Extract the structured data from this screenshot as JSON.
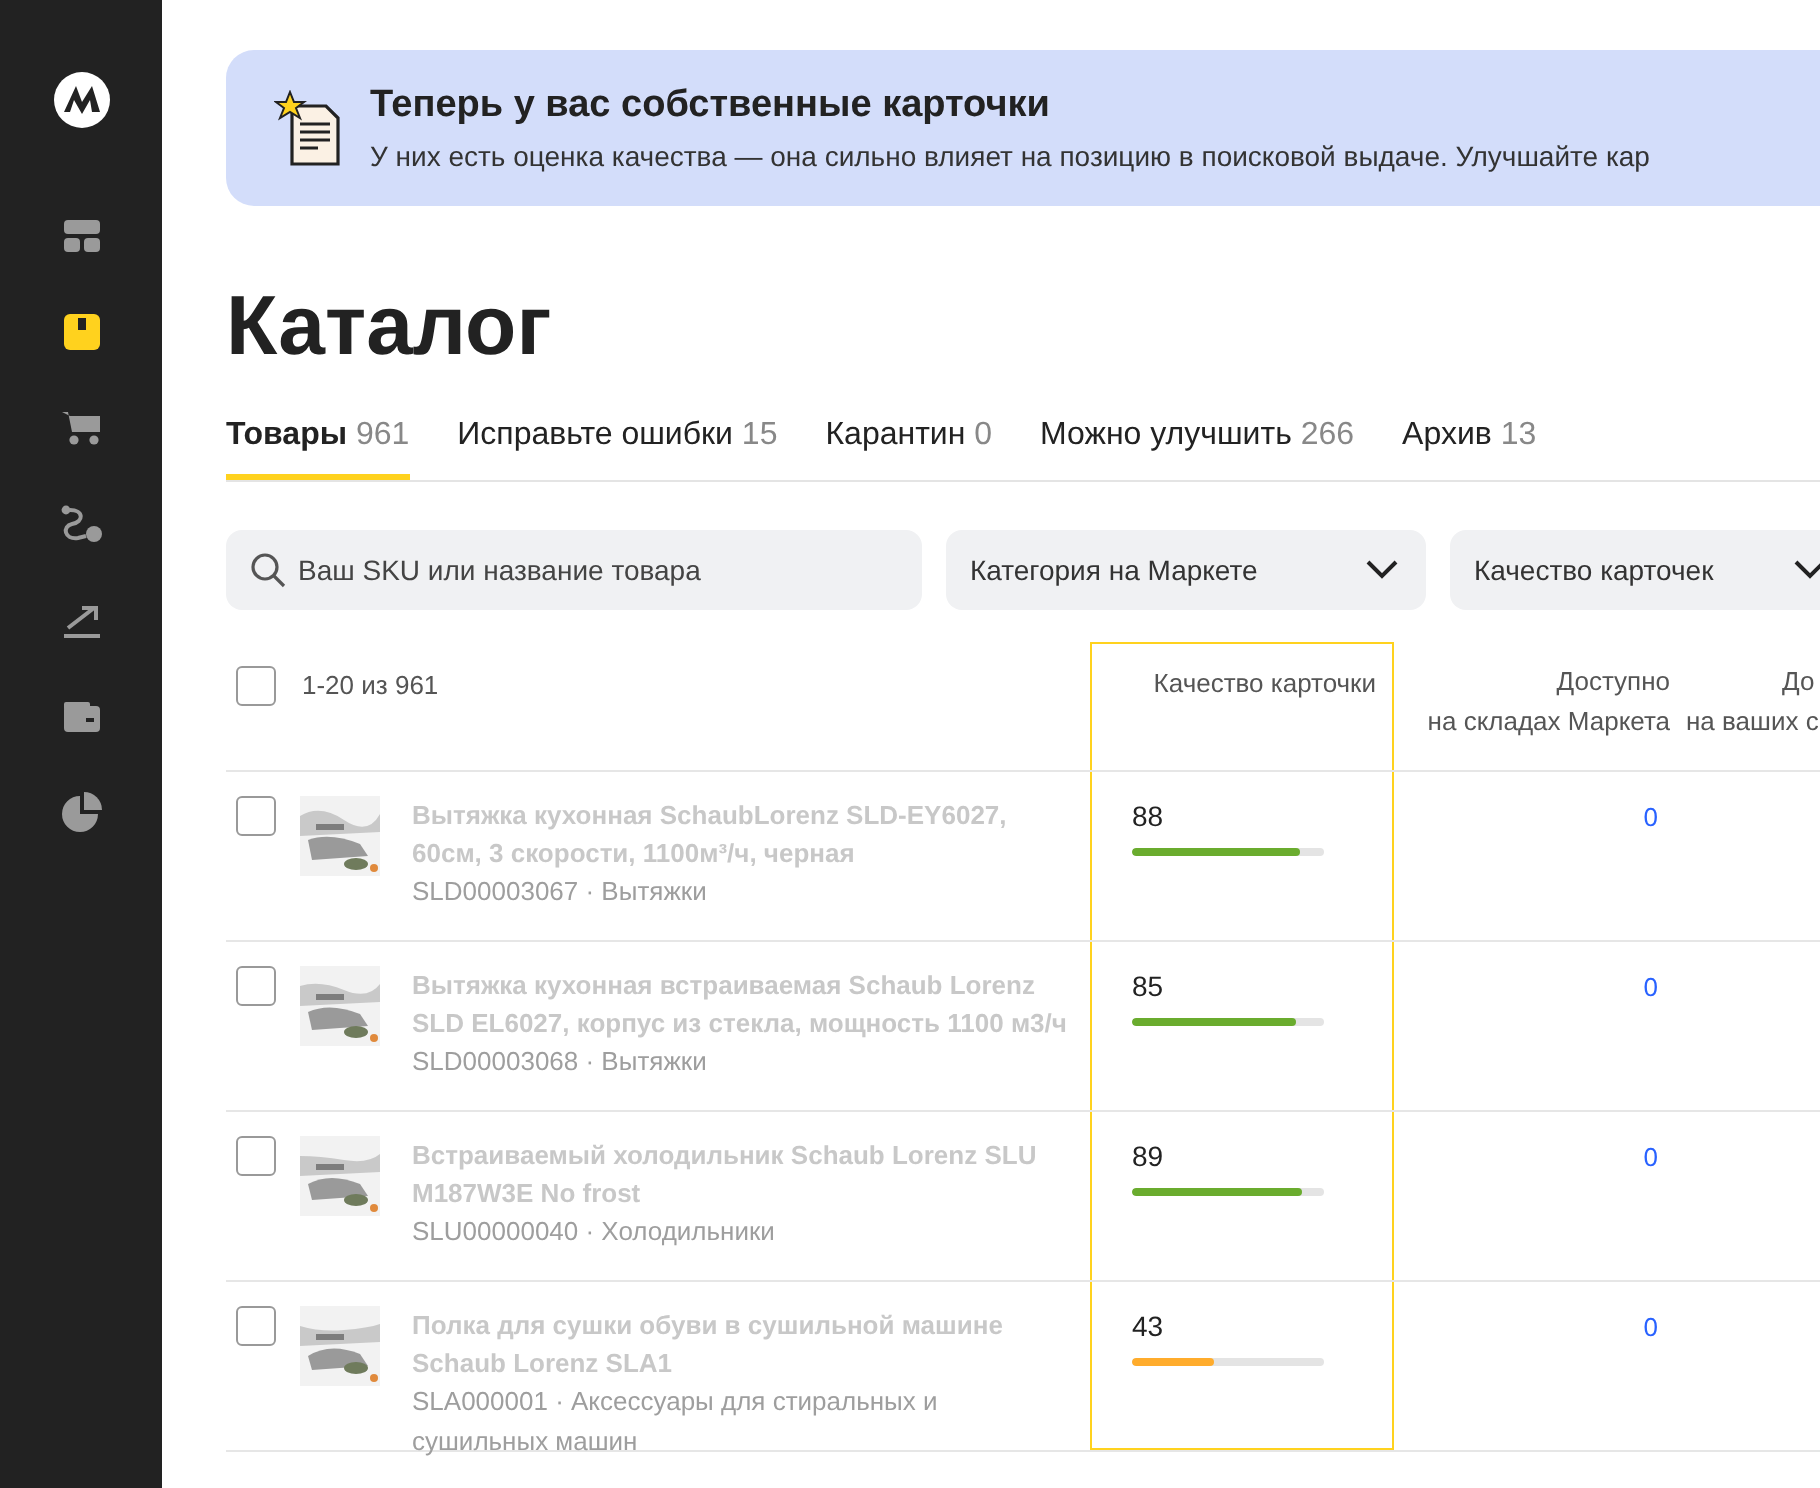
{
  "sidebar": {
    "items": [
      {
        "selected": false
      },
      {
        "selected": true
      },
      {
        "selected": false
      },
      {
        "selected": false
      },
      {
        "selected": false
      },
      {
        "selected": false
      },
      {
        "selected": false
      }
    ]
  },
  "banner": {
    "title": "Теперь у вас собственные карточки",
    "text": "У них есть оценка качества — она сильно влияет на позицию в поисковой выдаче. Улучшайте кар"
  },
  "page_title": "Каталог",
  "tabs": [
    {
      "label": "Товары",
      "count": "961",
      "selected": true
    },
    {
      "label": "Исправьте ошибки",
      "count": "15",
      "selected": false
    },
    {
      "label": "Карантин",
      "count": "0",
      "selected": false
    },
    {
      "label": "Можно улучшить",
      "count": "266",
      "selected": false
    },
    {
      "label": "Архив",
      "count": "13",
      "selected": false
    }
  ],
  "filters": {
    "search": {
      "placeholder": "Ваш SKU или название товара"
    },
    "dropdowns": [
      "Категория на Маркете",
      "Качество карточек"
    ]
  },
  "table": {
    "all_checked": false,
    "range": "1-20 из 961",
    "columns": [
      {
        "lines": [
          "Качество карточки"
        ],
        "highlighted": true
      },
      {
        "lines": [
          "Доступно",
          "на складах Маркета"
        ],
        "highlighted": false
      },
      {
        "lines": [
          "До",
          "на ваших с"
        ],
        "highlighted": false
      }
    ],
    "rows": [
      {
        "checked": false,
        "name": "Вытяжка кухонная SchaubLorenz SLD-EY6027, 60см, 3 скорости, 1100м³/ч, черная",
        "sku": "SLD00003067 · Вытяжки",
        "score": "88",
        "level": 0.88,
        "color": "#6aac2e",
        "available": "0"
      },
      {
        "checked": false,
        "name": "Вытяжка кухонная встраиваемая Schaub Lorenz SLD EL6027, корпус из стекла, мощность 1100 м3/ч",
        "sku": "SLD00003068 · Вытяжки",
        "score": "85",
        "level": 0.85,
        "color": "#6aac2e",
        "available": "0"
      },
      {
        "checked": false,
        "name": "Встраиваемый холодильник Schaub Lorenz SLU M187W3E No frost",
        "sku": "SLU00000040 · Холодильники",
        "score": "89",
        "level": 0.89,
        "color": "#6aac2e",
        "available": "0"
      },
      {
        "checked": false,
        "name": "Полка для сушки обуви в сушильной машине Schaub Lorenz SLA1",
        "sku": "SLA000001 · Аксессуары для стиральных и сушильных машин",
        "score": "43",
        "level": 0.43,
        "color": "#ffac2c",
        "available": "0"
      }
    ]
  }
}
